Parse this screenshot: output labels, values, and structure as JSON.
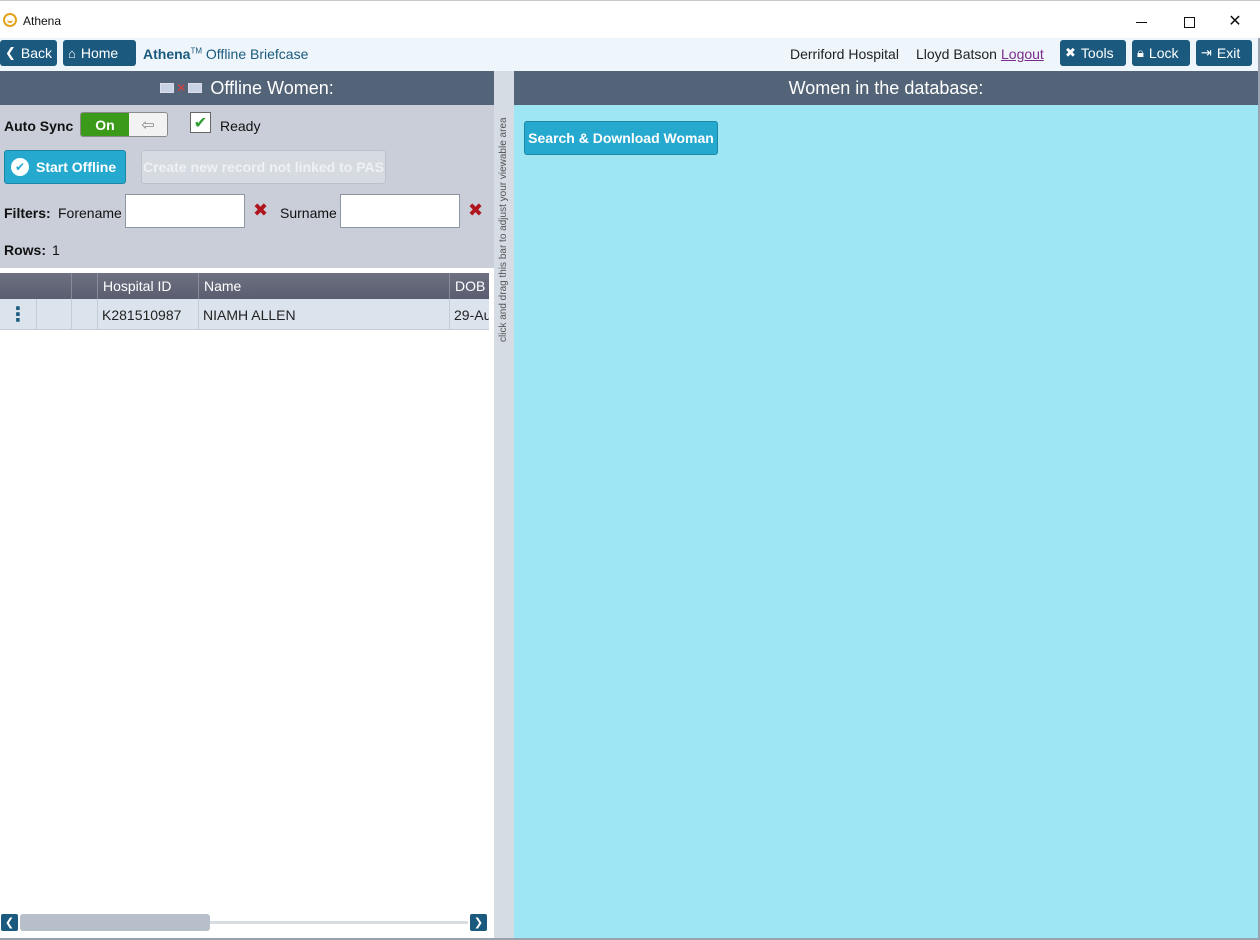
{
  "window": {
    "title": "Athena",
    "icon": "athena-logo-icon"
  },
  "nav": {
    "back_label": "Back",
    "home_label": "Home",
    "breadcrumb_brand": "Athena",
    "breadcrumb_tm": "TM",
    "breadcrumb_page": "Offline Briefcase",
    "hospital": "Derriford Hospital",
    "user": "Lloyd Batson",
    "logout_label": "Logout",
    "tools_label": "Tools",
    "lock_label": "Lock",
    "exit_label": "Exit"
  },
  "left_pane": {
    "header": "Offline Women:",
    "auto_sync_label": "Auto Sync",
    "auto_sync_state": "On",
    "ready_label": "Ready",
    "start_offline_label": "Start Offline",
    "create_record_label": "Create new record not linked to PAS",
    "filters_label": "Filters:",
    "forename_label": "Forename",
    "forename_value": "",
    "surname_label": "Surname",
    "surname_value": "",
    "rows_label": "Rows:",
    "rows_count": "1",
    "grid": {
      "columns": [
        "Hospital ID",
        "Name",
        "DOB"
      ],
      "rows": [
        {
          "hospital_id": "K281510987",
          "name": "NIAMH ALLEN",
          "dob": "29-Au"
        }
      ]
    }
  },
  "splitter": {
    "hint": "click and drag this bar to adjust your viewable area"
  },
  "right_pane": {
    "header": "Women in the database:",
    "search_button_label": "Search & Download Woman"
  },
  "colors": {
    "accent": "#1b5a7e",
    "header_bg": "#536478",
    "button_cyan": "#26a9cf",
    "right_bg": "#9fe6f5",
    "toggle_on": "#3c9a1a"
  }
}
